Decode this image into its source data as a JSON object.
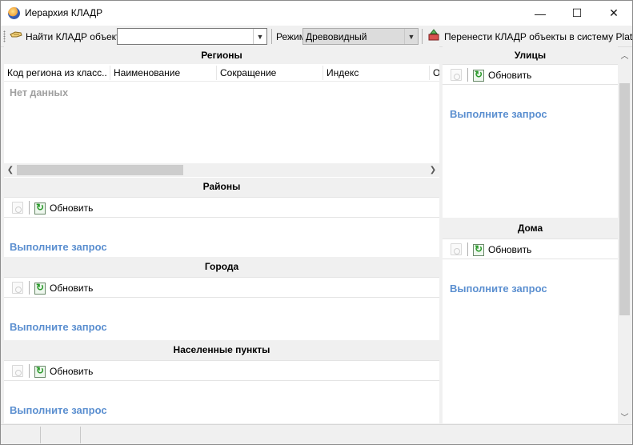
{
  "window": {
    "title": "Иерархия КЛАДР",
    "minimize_glyph": "—",
    "maximize_glyph": "☐",
    "close_glyph": "✕"
  },
  "toolbar": {
    "find_label": "Найти КЛАДР объект",
    "find_value": "",
    "mode_label": "Режим",
    "mode_value": "Древовидный",
    "transfer_label": "Перенести КЛАДР объекты в систему Platex"
  },
  "regions": {
    "title": "Регионы",
    "columns": [
      "Код региона из класс...",
      "Наименование",
      "Сокращение",
      "Индекс",
      "О"
    ],
    "empty_text": "Нет данных"
  },
  "districts": {
    "title": "Районы",
    "refresh_label": "Обновить",
    "request_text": "Выполните запрос"
  },
  "cities": {
    "title": "Города",
    "refresh_label": "Обновить",
    "request_text": "Выполните запрос"
  },
  "settlements": {
    "title": "Населенные пункты",
    "refresh_label": "Обновить",
    "request_text": "Выполните запрос"
  },
  "streets": {
    "title": "Улицы",
    "refresh_label": "Обновить",
    "request_text": "Выполните запрос"
  },
  "houses": {
    "title": "Дома",
    "refresh_label": "Обновить",
    "request_text": "Выполните запрос"
  },
  "colors": {
    "link_blue": "#5b8fd0",
    "muted_gray": "#a0a0a0",
    "chrome": "#f0f0f0"
  },
  "icons": [
    "app-globe-icon",
    "find-hand-icon",
    "transfer-icon",
    "search-disabled-icon",
    "refresh-icon"
  ]
}
